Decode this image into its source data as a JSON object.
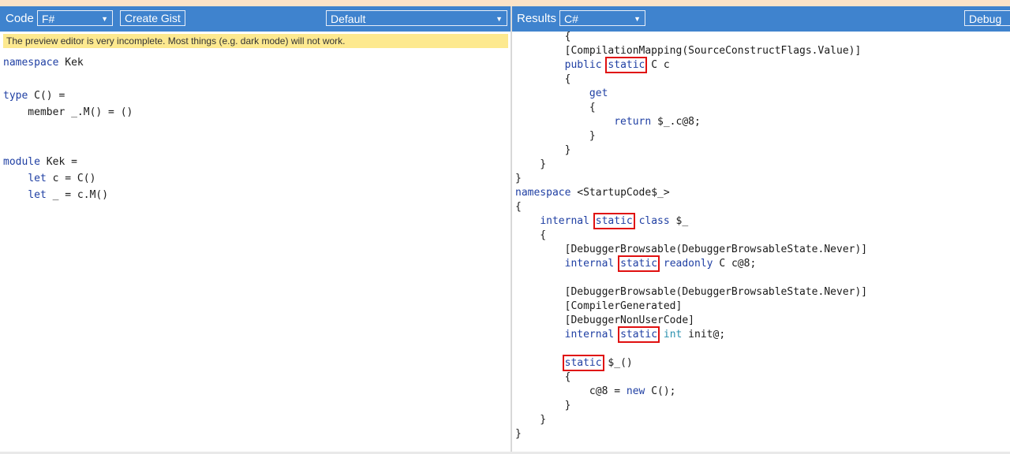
{
  "left_toolbar": {
    "code_label": "Code",
    "language_select": "F#",
    "create_gist_label": "Create Gist",
    "branch_select": "Default"
  },
  "right_toolbar": {
    "results_label": "Results",
    "target_select": "C#",
    "mode_select": "Debug"
  },
  "notice": "The preview editor is very incomplete. Most things (e.g. dark mode) will not work.",
  "fsharp_lines": [
    [
      [
        "kw",
        "namespace"
      ],
      [
        "t",
        " Kek"
      ]
    ],
    [],
    [
      [
        "kw",
        "type"
      ],
      [
        "t",
        " C() ="
      ]
    ],
    [
      [
        "t",
        "    member _.M() = ()"
      ]
    ],
    [],
    [],
    [
      [
        "kw",
        "module"
      ],
      [
        "t",
        " Kek ="
      ]
    ],
    [
      [
        "t",
        "    "
      ],
      [
        "kw",
        "let"
      ],
      [
        "t",
        " c = C()"
      ]
    ],
    [
      [
        "t",
        "    "
      ],
      [
        "kw",
        "let"
      ],
      [
        "t",
        " _ = c.M()"
      ]
    ]
  ],
  "csharp_lines": [
    [
      [
        "t",
        "        {"
      ]
    ],
    [
      [
        "t",
        "        [CompilationMapping(SourceConstructFlags.Value)]"
      ]
    ],
    [
      [
        "t",
        "        "
      ],
      [
        "kw",
        "public"
      ],
      [
        "t",
        " "
      ],
      [
        "hl",
        "static"
      ],
      [
        "t",
        " C c"
      ]
    ],
    [
      [
        "t",
        "        {"
      ]
    ],
    [
      [
        "t",
        "            "
      ],
      [
        "kw",
        "get"
      ]
    ],
    [
      [
        "t",
        "            {"
      ]
    ],
    [
      [
        "t",
        "                "
      ],
      [
        "kw",
        "return"
      ],
      [
        "t",
        " $_.c@8;"
      ]
    ],
    [
      [
        "t",
        "            }"
      ]
    ],
    [
      [
        "t",
        "        }"
      ]
    ],
    [
      [
        "t",
        "    }"
      ]
    ],
    [
      [
        "t",
        "}"
      ]
    ],
    [
      [
        "kw",
        "namespace"
      ],
      [
        "t",
        " <StartupCode$_>"
      ]
    ],
    [
      [
        "t",
        "{"
      ]
    ],
    [
      [
        "t",
        "    "
      ],
      [
        "kw",
        "internal"
      ],
      [
        "t",
        " "
      ],
      [
        "hl",
        "static"
      ],
      [
        "t",
        " "
      ],
      [
        "kw",
        "class"
      ],
      [
        "t",
        " $_"
      ]
    ],
    [
      [
        "t",
        "    {"
      ]
    ],
    [
      [
        "t",
        "        [DebuggerBrowsable(DebuggerBrowsableState.Never)]"
      ]
    ],
    [
      [
        "t",
        "        "
      ],
      [
        "kw",
        "internal"
      ],
      [
        "t",
        " "
      ],
      [
        "hl",
        "static"
      ],
      [
        "t",
        " "
      ],
      [
        "kw",
        "readonly"
      ],
      [
        "t",
        " C c@8;"
      ]
    ],
    [],
    [
      [
        "t",
        "        [DebuggerBrowsable(DebuggerBrowsableState.Never)]"
      ]
    ],
    [
      [
        "t",
        "        [CompilerGenerated]"
      ]
    ],
    [
      [
        "t",
        "        [DebuggerNonUserCode]"
      ]
    ],
    [
      [
        "t",
        "        "
      ],
      [
        "kw",
        "internal"
      ],
      [
        "t",
        " "
      ],
      [
        "hl",
        "static"
      ],
      [
        "t",
        " "
      ],
      [
        "tl",
        "int"
      ],
      [
        "t",
        " init@;"
      ]
    ],
    [],
    [
      [
        "t",
        "        "
      ],
      [
        "hl",
        "static"
      ],
      [
        "t",
        " $_()"
      ]
    ],
    [
      [
        "t",
        "        {"
      ]
    ],
    [
      [
        "t",
        "            c@8 = "
      ],
      [
        "kw",
        "new"
      ],
      [
        "t",
        " C();"
      ]
    ],
    [
      [
        "t",
        "        }"
      ]
    ],
    [
      [
        "t",
        "    }"
      ]
    ],
    [
      [
        "t",
        "}"
      ]
    ]
  ]
}
